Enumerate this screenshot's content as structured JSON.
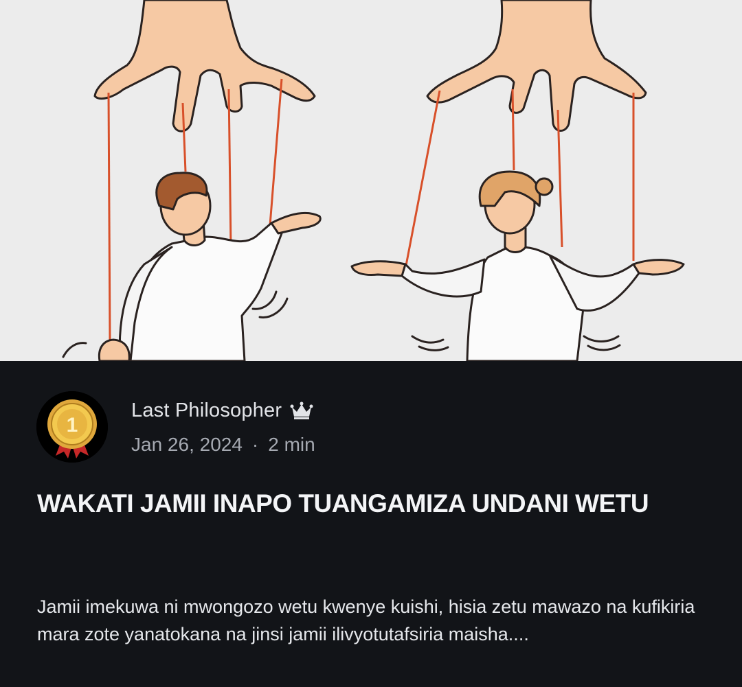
{
  "post": {
    "cover_image": "puppet-strings-illustration",
    "author": {
      "name": "Last Philosopher",
      "avatar_icon": "gold-medal-icon",
      "avatar_text": "1",
      "badge_icon": "crown-icon"
    },
    "meta": {
      "date": "Jan 26, 2024",
      "separator": "·",
      "read_time": "2 min"
    },
    "title": "WAKATI JAMII INAPO TUANGAMIZA UNDANI WETU",
    "excerpt": "Jamii imekuwa ni mwongozo wetu kwenye kuishi, hisia zetu mawazo na kufikiria mara zote yanatokana na jinsi jamii ilivyotutafsiria maisha...."
  },
  "colors": {
    "background": "#121418",
    "title": "#f4f5f7",
    "meta": "#a6aab2",
    "string": "#d8502a",
    "medal": "#d9a23a"
  }
}
